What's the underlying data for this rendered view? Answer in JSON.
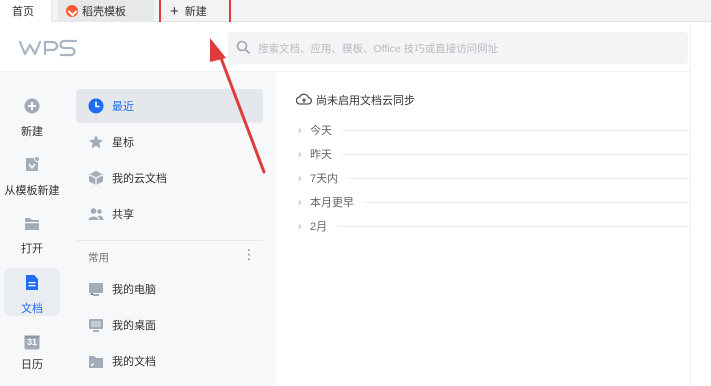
{
  "tabs": {
    "home": "首页",
    "template": "稻壳模板",
    "new": "新建"
  },
  "header": {
    "logo_text": "WPS",
    "search_placeholder": "搜索文档、应用、模板、Office 技巧或直接访问网址"
  },
  "rail": {
    "items": [
      {
        "label": "新建",
        "icon": "plus-circle-icon"
      },
      {
        "label": "从模板新建",
        "icon": "template-icon"
      },
      {
        "label": "打开",
        "icon": "folder-icon"
      },
      {
        "label": "文档",
        "icon": "document-icon"
      },
      {
        "label": "日历",
        "icon": "calendar-icon",
        "day": "31"
      }
    ]
  },
  "nav": {
    "items": [
      {
        "label": "最近",
        "icon": "clock-icon"
      },
      {
        "label": "星标",
        "icon": "star-icon"
      },
      {
        "label": "我的云文档",
        "icon": "cloud-box-icon"
      },
      {
        "label": "共享",
        "icon": "people-icon"
      }
    ],
    "section_title": "常用",
    "section_more": "⋮",
    "common": [
      {
        "label": "我的电脑",
        "icon": "computer-icon"
      },
      {
        "label": "我的桌面",
        "icon": "desktop-icon"
      },
      {
        "label": "我的文档",
        "icon": "folder-shortcut-icon"
      }
    ]
  },
  "main": {
    "sync_status": "尚未启用文档云同步",
    "groups": [
      "今天",
      "昨天",
      "7天内",
      "本月更早",
      "2月"
    ]
  },
  "colors": {
    "accent": "#1d6cf2",
    "annotation": "#e03a3a"
  }
}
